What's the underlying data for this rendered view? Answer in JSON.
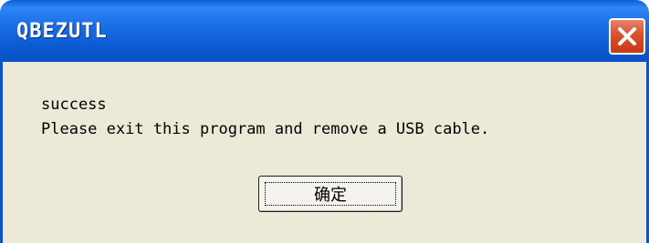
{
  "window": {
    "title": "QBEZUTL",
    "close_icon": "close-icon"
  },
  "message": {
    "line1": "success",
    "line2": "Please exit this program and remove a USB cable."
  },
  "ok_button": {
    "label": "确定"
  },
  "colors": {
    "titlebar": "#0a52c6",
    "close": "#d9512c",
    "body": "#ece9d8"
  }
}
